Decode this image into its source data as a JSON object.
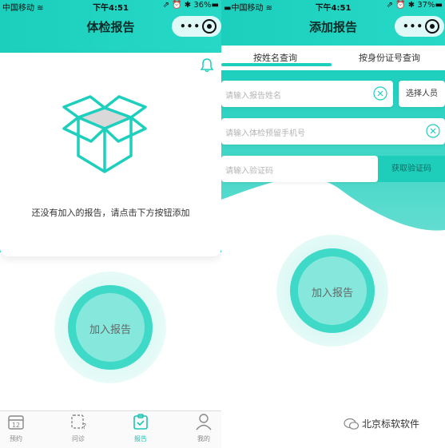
{
  "left": {
    "status": {
      "carrier": "中国移动 ≋",
      "time": "下午4:51",
      "right": "⇗ ⏰ ✱ 36%▬"
    },
    "nav_title": "体检报告",
    "capsule_dots": "•••",
    "empty_text": "还没有加入的报告，请点击下方按钮添加",
    "add_button": "加入报告",
    "tabbar": [
      {
        "label": "预约",
        "icon": "calendar-icon"
      },
      {
        "label": "问诊",
        "icon": "consult-icon"
      },
      {
        "label": "报告",
        "icon": "report-icon"
      },
      {
        "label": "我的",
        "icon": "user-icon"
      }
    ]
  },
  "right": {
    "status": {
      "carrier": "▬中国移动 ≋",
      "time": "下午4:51",
      "right": "⇗ ⏰ ✱ 37%▬"
    },
    "nav_title": "添加报告",
    "capsule_dots": "•••",
    "tabs": [
      "按姓名查询",
      "按身份证号查询"
    ],
    "name_placeholder": "请输入报告姓名",
    "select_label": "选择人员",
    "phone_placeholder": "请输入体检预留手机号",
    "code_placeholder": "请输入验证码",
    "code_button": "获取验证码",
    "add_button": "加入报告"
  },
  "watermark": "北京标软软件",
  "colors": {
    "accent": "#1ccfbd",
    "accent_light": "#9eeee4"
  }
}
